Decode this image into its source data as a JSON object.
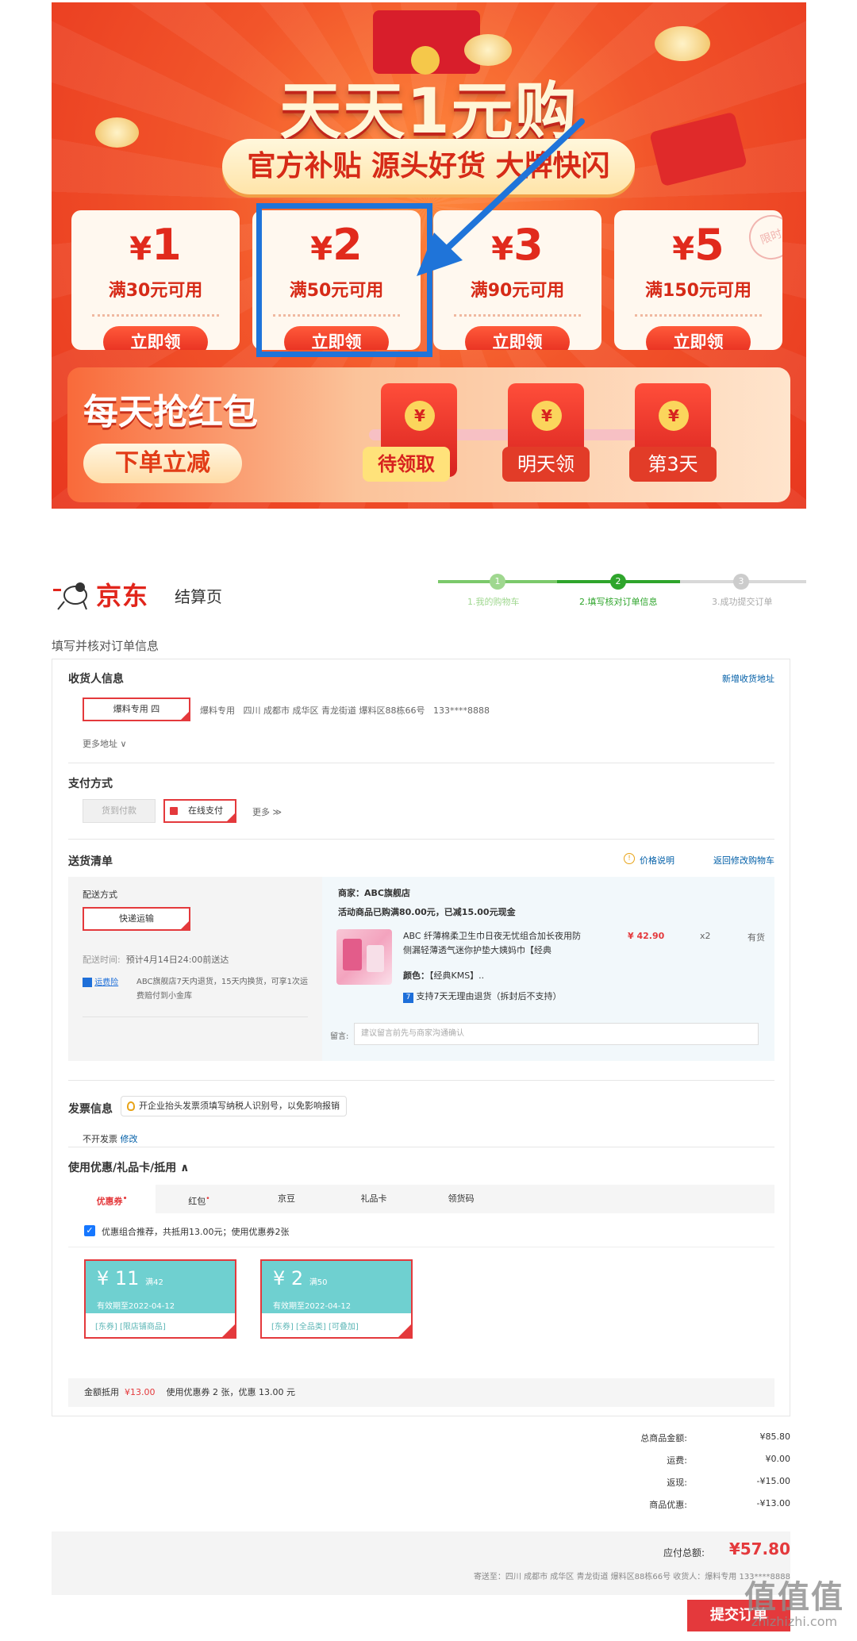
{
  "promo": {
    "title": "天天1元购",
    "subtitle": "官方补贴 源头好货 大牌快闪",
    "coupons": [
      {
        "currency": "¥",
        "amount": "1",
        "condition": "满30元可用",
        "button": "立即领"
      },
      {
        "currency": "¥",
        "amount": "2",
        "condition": "满50元可用",
        "button": "立即领"
      },
      {
        "currency": "¥",
        "amount": "3",
        "condition": "满90元可用",
        "button": "立即领"
      },
      {
        "currency": "¥",
        "amount": "5",
        "condition": "满150元可用",
        "button": "立即领"
      }
    ],
    "stamp": "限时",
    "daily_title": "每天抢红包",
    "daily_button": "下单立减",
    "redpacks": [
      {
        "label": "待领取",
        "coin": "¥"
      },
      {
        "label": "明天领",
        "coin": "¥"
      },
      {
        "label": "第3天",
        "coin": "¥"
      }
    ],
    "colors": {
      "highlight": "#1f74d9",
      "accent": "#e12a1c"
    }
  },
  "header": {
    "logo_text": "京东",
    "page_name": "结算页",
    "steps": [
      {
        "num": "1",
        "label": "1.我的购物车"
      },
      {
        "num": "2",
        "label": "2.填写核对订单信息"
      },
      {
        "num": "3",
        "label": "3.成功提交订单"
      }
    ]
  },
  "main_title": "填写并核对订单信息",
  "consignee": {
    "heading": "收货人信息",
    "add_link": "新增收货地址",
    "selected_name": "爆料专用 四",
    "name": "爆料专用",
    "address": "四川 成都市 成华区 青龙街道 爆料区88栋66号",
    "phone": "133****8888",
    "more": "更多地址 ∨"
  },
  "payment": {
    "heading": "支付方式",
    "cod": "货到付款",
    "online": "在线支付",
    "more": "更多 ≫"
  },
  "shipping": {
    "heading": "送货清单",
    "price_note": "价格说明",
    "back_cart": "返回修改购物车",
    "method_label": "配送方式",
    "method_value": "快递运输",
    "time_label": "配送时间:",
    "time_value": "预计4月14日24:00前送达",
    "insurance_badge": "运费险",
    "insurance_text": "ABC旗舰店7天内退货，15天内换货，可享1次运费赔付到小金库",
    "seller": "商家：ABC旗舰店",
    "promo_line": "活动商品已购满80.00元，已减15.00元现金",
    "product_name": "ABC 纤薄棉柔卫生巾日夜无忧组合加长夜用防侧漏轻薄透气迷你护垫大姨妈巾【经典",
    "price": "¥ 42.90",
    "qty": "x2",
    "stock": "有货",
    "color_label": "颜色：",
    "color_value": "【经典KMS】..",
    "return_badge": "7",
    "return_text": "支持7天无理由退货（拆封后不支持）",
    "message_label": "留言:",
    "message_placeholder": "建议留言前先与商家沟通确认"
  },
  "invoice": {
    "heading": "发票信息",
    "tip": "开企业抬头发票须填写纳税人识别号，以免影响报销",
    "status": "不开发票",
    "edit": "修改"
  },
  "discount": {
    "heading": "使用优惠/礼品卡/抵用 ∧",
    "tabs": [
      "优惠券",
      "红包",
      "京豆",
      "礼品卡",
      "领货码"
    ],
    "combo_text": "优惠组合推荐，共抵用13.00元；使用优惠券2张",
    "coupons": [
      {
        "amount": "¥ 11",
        "condition": "满42",
        "expiry": "有效期至2022-04-12",
        "tags": "[东券]  [限店铺商品]"
      },
      {
        "amount": "¥ 2",
        "condition": "满50",
        "expiry": "有效期至2022-04-12",
        "tags": "[东券]  [全品类]  [可叠加]"
      }
    ],
    "summary_label": "金额抵用",
    "summary_amount": "¥13.00",
    "summary_text": "使用优惠券 2 张，优惠 13.00 元"
  },
  "summary": [
    {
      "k": "总商品金额:",
      "v": "¥85.80"
    },
    {
      "k": "运费:",
      "v": "¥0.00"
    },
    {
      "k": "返现:",
      "v": "-¥15.00"
    },
    {
      "k": "商品优惠:",
      "v": "-¥13.00"
    }
  ],
  "pay": {
    "total_label": "应付总额:",
    "total_value": "¥57.80",
    "address_line": "寄送至：四川 成都市 成华区 青龙街道 爆料区88栋66号    收货人：爆料专用 133****8888",
    "submit": "提交订单"
  },
  "watermark": {
    "glyphs": "值值值",
    "url": "zhizhizhi.com"
  }
}
